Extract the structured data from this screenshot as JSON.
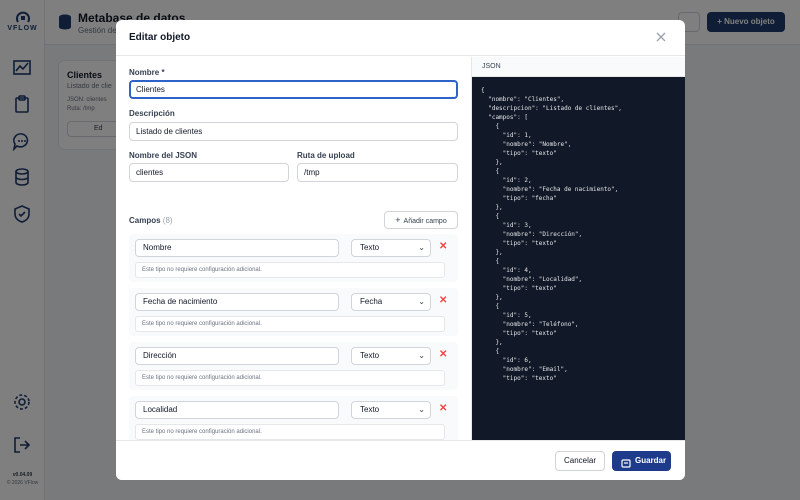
{
  "brand": {
    "logo_text": "VFLOW",
    "version": "v0.04.09",
    "copyright": "© 2026 VFlow"
  },
  "background": {
    "title": "Metabase de datos",
    "subtitle": "Gestión de",
    "new_button": "+ Nuevo objeto",
    "card": {
      "title": "Clientes",
      "subtitle": "Listado de clie",
      "json_line": "JSON: clientes",
      "route_line": "Ruta: /tmp",
      "edit_label": "Ed"
    }
  },
  "modal": {
    "title": "Editar objeto",
    "name_label": "Nombre *",
    "name_value": "Clientes",
    "description_label": "Descripción",
    "description_value": "Listado de clientes",
    "json_name_label": "Nombre del JSON",
    "json_name_value": "clientes",
    "upload_route_label": "Ruta de upload",
    "upload_route_value": "/tmp",
    "fields_label": "Campos",
    "fields_count": "(8)",
    "add_field_label": "Añadir campo",
    "fields": [
      {
        "name": "Nombre",
        "type": "Texto",
        "note": "Este tipo no requiere configuración adicional."
      },
      {
        "name": "Fecha de nacimiento",
        "type": "Fecha",
        "note": "Este tipo no requiere configuración adicional."
      },
      {
        "name": "Dirección",
        "type": "Texto",
        "note": "Este tipo no requiere configuración adicional."
      },
      {
        "name": "Localidad",
        "type": "Texto",
        "note": "Este tipo no requiere configuración adicional."
      }
    ],
    "json_panel_title": "JSON",
    "json_lines": [
      "{",
      "  \"nombre\": \"Clientes\",",
      "  \"descripcion\": \"Listado de clientes\",",
      "  \"campos\": [",
      "    {",
      "      \"id\": 1,",
      "      \"nombre\": \"Nombre\",",
      "      \"tipo\": \"texto\"",
      "    },",
      "    {",
      "      \"id\": 2,",
      "      \"nombre\": \"Fecha de nacimiento\",",
      "      \"tipo\": \"fecha\"",
      "    },",
      "    {",
      "      \"id\": 3,",
      "      \"nombre\": \"Dirección\",",
      "      \"tipo\": \"texto\"",
      "    },",
      "    {",
      "      \"id\": 4,",
      "      \"nombre\": \"Localidad\",",
      "      \"tipo\": \"texto\"",
      "    },",
      "    {",
      "      \"id\": 5,",
      "      \"nombre\": \"Teléfono\",",
      "      \"tipo\": \"texto\"",
      "    },",
      "    {",
      "      \"id\": 6,",
      "      \"nombre\": \"Email\",",
      "      \"tipo\": \"texto\""
    ],
    "cancel_label": "Cancelar",
    "save_label": "Guardar"
  },
  "colors": {
    "accent": "#1e3a8a",
    "brand": "#1e3a6e",
    "danger": "#ef4444",
    "code_bg": "#111827"
  },
  "icons": [
    "vflow-logo-icon",
    "chart-icon",
    "clipboard-icon",
    "chat-icon",
    "database-icon",
    "shield-icon",
    "settings-icon",
    "logout-icon",
    "close-icon",
    "plus-icon",
    "delete-icon",
    "save-icon"
  ]
}
